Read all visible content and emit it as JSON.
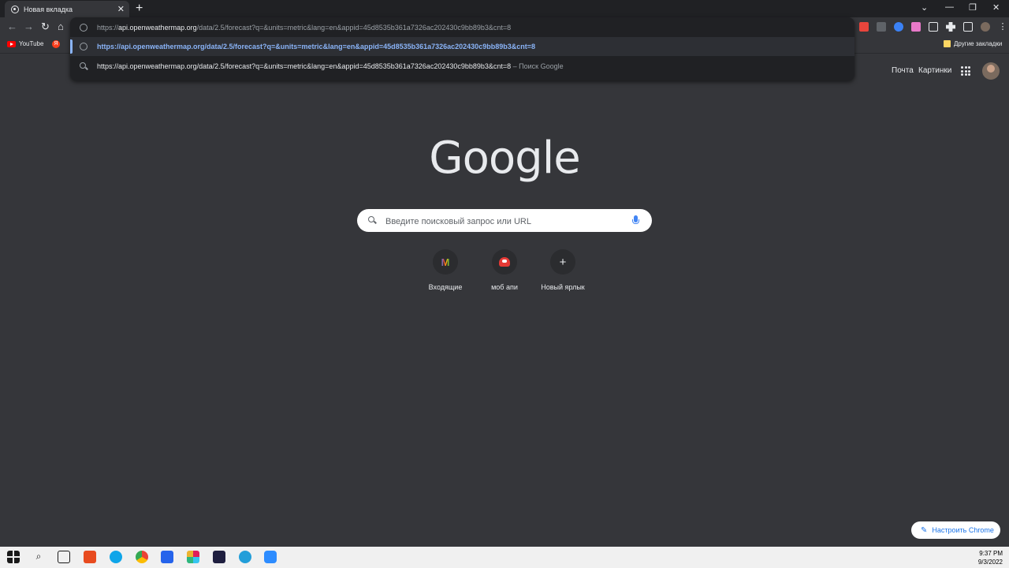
{
  "browser": {
    "tab_title": "Новая вкладка",
    "tab_close": "✕",
    "new_tab": "+",
    "window_controls": [
      "⌄",
      "—",
      "❐",
      "✕"
    ]
  },
  "omnibox": {
    "input_prefix": "https://",
    "input_host": "api.openweathermap.org",
    "input_rest": "/data/2.5/forecast?q=&units=metric&lang=en&appid=45d8535b361a7326ac202430c9bb89b3&cnt=8",
    "suggestion_url": "https://api.openweathermap.org/data/2.5/forecast?q=&units=metric&lang=en&appid=45d8535b361a7326ac202430c9bb89b3&cnt=8",
    "suggestion_search": "https://api.openweathermap.org/data/2.5/forecast?q=&units=metric&lang=en&appid=45d8535b361a7326ac202430c9bb89b3&cnt=8",
    "search_hint": " – Поиск Google"
  },
  "bookmarks": {
    "youtube": "YouTube",
    "yandex": "Я",
    "other": "Другие закладки"
  },
  "google": {
    "mail": "Почта",
    "images": "Картинки",
    "logo": "Google",
    "search_placeholder": "Введите поисковый запрос или URL",
    "shortcuts": [
      {
        "label": "Входящие",
        "icon": "gmail-icon"
      },
      {
        "label": "моб апи",
        "icon": "mushroom-icon"
      },
      {
        "label": "Новый ярлык",
        "icon": "plus-icon"
      }
    ],
    "customize": "Настроить Chrome"
  },
  "taskbar": {
    "time": "9:37 PM",
    "date": "9/3/2022"
  },
  "colors": {
    "background": "#35363a",
    "accent": "#8ab4f8"
  }
}
